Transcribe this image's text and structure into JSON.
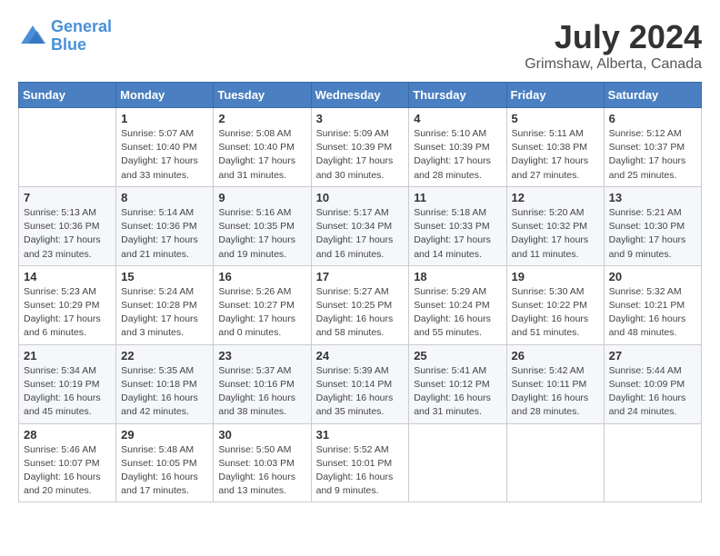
{
  "header": {
    "logo_line1": "General",
    "logo_line2": "Blue",
    "month": "July 2024",
    "location": "Grimshaw, Alberta, Canada"
  },
  "weekdays": [
    "Sunday",
    "Monday",
    "Tuesday",
    "Wednesday",
    "Thursday",
    "Friday",
    "Saturday"
  ],
  "weeks": [
    [
      {
        "day": "",
        "info": ""
      },
      {
        "day": "1",
        "info": "Sunrise: 5:07 AM\nSunset: 10:40 PM\nDaylight: 17 hours\nand 33 minutes."
      },
      {
        "day": "2",
        "info": "Sunrise: 5:08 AM\nSunset: 10:40 PM\nDaylight: 17 hours\nand 31 minutes."
      },
      {
        "day": "3",
        "info": "Sunrise: 5:09 AM\nSunset: 10:39 PM\nDaylight: 17 hours\nand 30 minutes."
      },
      {
        "day": "4",
        "info": "Sunrise: 5:10 AM\nSunset: 10:39 PM\nDaylight: 17 hours\nand 28 minutes."
      },
      {
        "day": "5",
        "info": "Sunrise: 5:11 AM\nSunset: 10:38 PM\nDaylight: 17 hours\nand 27 minutes."
      },
      {
        "day": "6",
        "info": "Sunrise: 5:12 AM\nSunset: 10:37 PM\nDaylight: 17 hours\nand 25 minutes."
      }
    ],
    [
      {
        "day": "7",
        "info": "Sunrise: 5:13 AM\nSunset: 10:36 PM\nDaylight: 17 hours\nand 23 minutes."
      },
      {
        "day": "8",
        "info": "Sunrise: 5:14 AM\nSunset: 10:36 PM\nDaylight: 17 hours\nand 21 minutes."
      },
      {
        "day": "9",
        "info": "Sunrise: 5:16 AM\nSunset: 10:35 PM\nDaylight: 17 hours\nand 19 minutes."
      },
      {
        "day": "10",
        "info": "Sunrise: 5:17 AM\nSunset: 10:34 PM\nDaylight: 17 hours\nand 16 minutes."
      },
      {
        "day": "11",
        "info": "Sunrise: 5:18 AM\nSunset: 10:33 PM\nDaylight: 17 hours\nand 14 minutes."
      },
      {
        "day": "12",
        "info": "Sunrise: 5:20 AM\nSunset: 10:32 PM\nDaylight: 17 hours\nand 11 minutes."
      },
      {
        "day": "13",
        "info": "Sunrise: 5:21 AM\nSunset: 10:30 PM\nDaylight: 17 hours\nand 9 minutes."
      }
    ],
    [
      {
        "day": "14",
        "info": "Sunrise: 5:23 AM\nSunset: 10:29 PM\nDaylight: 17 hours\nand 6 minutes."
      },
      {
        "day": "15",
        "info": "Sunrise: 5:24 AM\nSunset: 10:28 PM\nDaylight: 17 hours\nand 3 minutes."
      },
      {
        "day": "16",
        "info": "Sunrise: 5:26 AM\nSunset: 10:27 PM\nDaylight: 17 hours\nand 0 minutes."
      },
      {
        "day": "17",
        "info": "Sunrise: 5:27 AM\nSunset: 10:25 PM\nDaylight: 16 hours\nand 58 minutes."
      },
      {
        "day": "18",
        "info": "Sunrise: 5:29 AM\nSunset: 10:24 PM\nDaylight: 16 hours\nand 55 minutes."
      },
      {
        "day": "19",
        "info": "Sunrise: 5:30 AM\nSunset: 10:22 PM\nDaylight: 16 hours\nand 51 minutes."
      },
      {
        "day": "20",
        "info": "Sunrise: 5:32 AM\nSunset: 10:21 PM\nDaylight: 16 hours\nand 48 minutes."
      }
    ],
    [
      {
        "day": "21",
        "info": "Sunrise: 5:34 AM\nSunset: 10:19 PM\nDaylight: 16 hours\nand 45 minutes."
      },
      {
        "day": "22",
        "info": "Sunrise: 5:35 AM\nSunset: 10:18 PM\nDaylight: 16 hours\nand 42 minutes."
      },
      {
        "day": "23",
        "info": "Sunrise: 5:37 AM\nSunset: 10:16 PM\nDaylight: 16 hours\nand 38 minutes."
      },
      {
        "day": "24",
        "info": "Sunrise: 5:39 AM\nSunset: 10:14 PM\nDaylight: 16 hours\nand 35 minutes."
      },
      {
        "day": "25",
        "info": "Sunrise: 5:41 AM\nSunset: 10:12 PM\nDaylight: 16 hours\nand 31 minutes."
      },
      {
        "day": "26",
        "info": "Sunrise: 5:42 AM\nSunset: 10:11 PM\nDaylight: 16 hours\nand 28 minutes."
      },
      {
        "day": "27",
        "info": "Sunrise: 5:44 AM\nSunset: 10:09 PM\nDaylight: 16 hours\nand 24 minutes."
      }
    ],
    [
      {
        "day": "28",
        "info": "Sunrise: 5:46 AM\nSunset: 10:07 PM\nDaylight: 16 hours\nand 20 minutes."
      },
      {
        "day": "29",
        "info": "Sunrise: 5:48 AM\nSunset: 10:05 PM\nDaylight: 16 hours\nand 17 minutes."
      },
      {
        "day": "30",
        "info": "Sunrise: 5:50 AM\nSunset: 10:03 PM\nDaylight: 16 hours\nand 13 minutes."
      },
      {
        "day": "31",
        "info": "Sunrise: 5:52 AM\nSunset: 10:01 PM\nDaylight: 16 hours\nand 9 minutes."
      },
      {
        "day": "",
        "info": ""
      },
      {
        "day": "",
        "info": ""
      },
      {
        "day": "",
        "info": ""
      }
    ]
  ]
}
